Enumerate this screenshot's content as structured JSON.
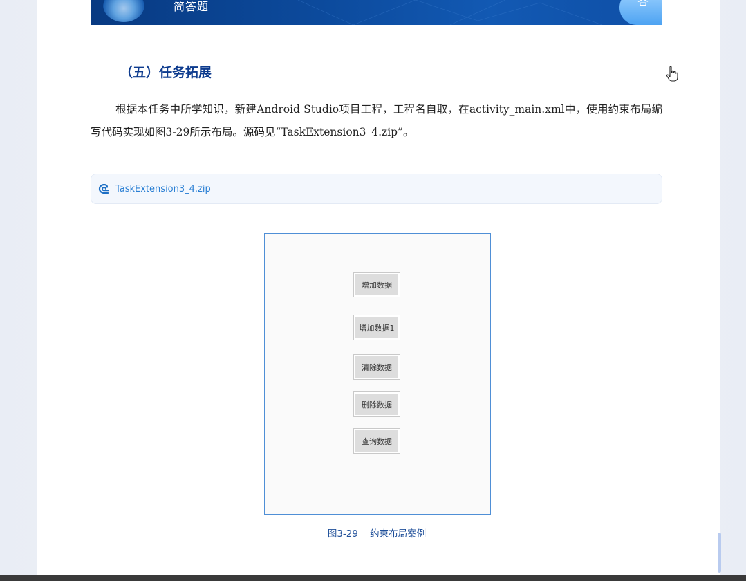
{
  "banner": {
    "title": "简答题",
    "badge_icon": "答"
  },
  "section": {
    "heading": "（五）任务拓展",
    "paragraph": "根据本任务中所学知识，新建Android Studio项目工程，工程名自取，在activity_main.xml中，使用约束布局编写代码实现如图3-29所示布局。源码见“TaskExtension3_4.zip”。"
  },
  "attachment": {
    "icon": "attachment-link-icon",
    "filename": "TaskExtension3_4.zip"
  },
  "figure": {
    "buttons": [
      "增加数据",
      "增加数据1",
      "清除数据",
      "删除数据",
      "查询数据"
    ],
    "caption": "图3-29    约束布局案例"
  },
  "colors": {
    "heading": "#0d3b8e",
    "link": "#2a7fd4",
    "frame_border": "#4f8fd6",
    "caption": "#1f4f99"
  }
}
